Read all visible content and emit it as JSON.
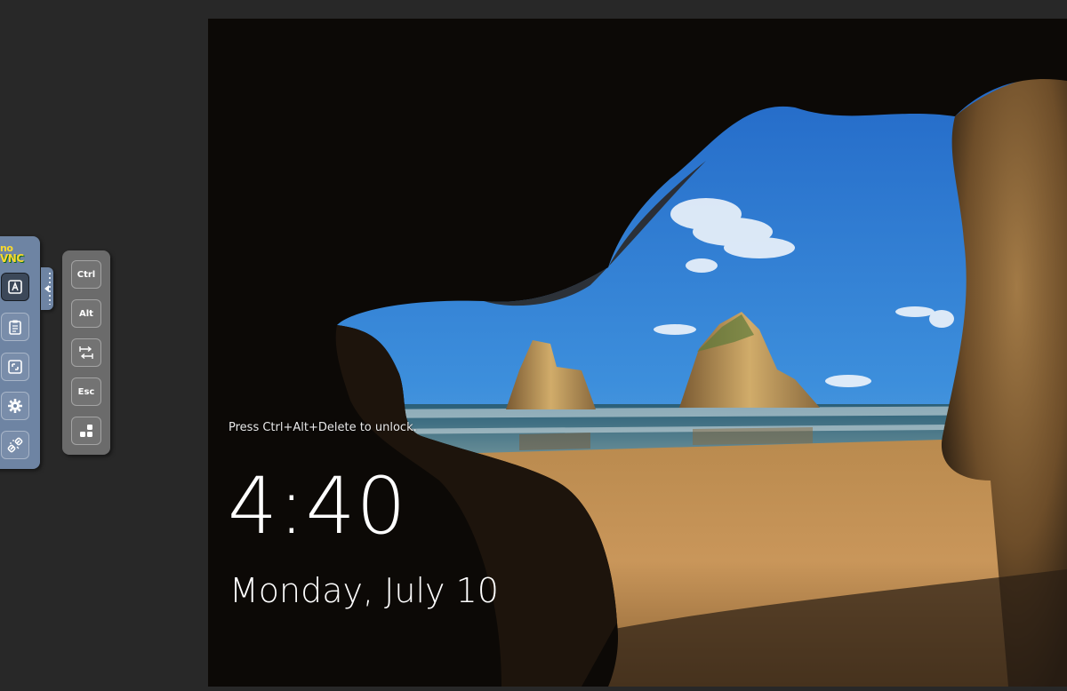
{
  "lock_screen": {
    "hint": "Press Ctrl+Alt+Delete to unlock.",
    "time": "4:40",
    "date": "Monday, July 10"
  },
  "control_bar": {
    "logo_no": "no",
    "logo_vnc": "VNC",
    "buttons": [
      {
        "icon": "keyboard-icon",
        "state": "active"
      },
      {
        "icon": "clipboard-icon"
      },
      {
        "icon": "fullscreen-icon"
      },
      {
        "icon": "gear-icon"
      },
      {
        "icon": "disconnect-icon"
      }
    ]
  },
  "extra_keys": {
    "ctrl": "Ctrl",
    "alt": "Alt",
    "tab_icon": "tab-icon",
    "esc": "Esc",
    "ctrl_alt_del_icon": "ctrl-alt-del-icon"
  },
  "colors": {
    "page_background": "#282828",
    "control_bar": "#6e84a3",
    "extra_keys_panel": "#6b6b6b",
    "logo_yellow": "#f8d92c"
  }
}
